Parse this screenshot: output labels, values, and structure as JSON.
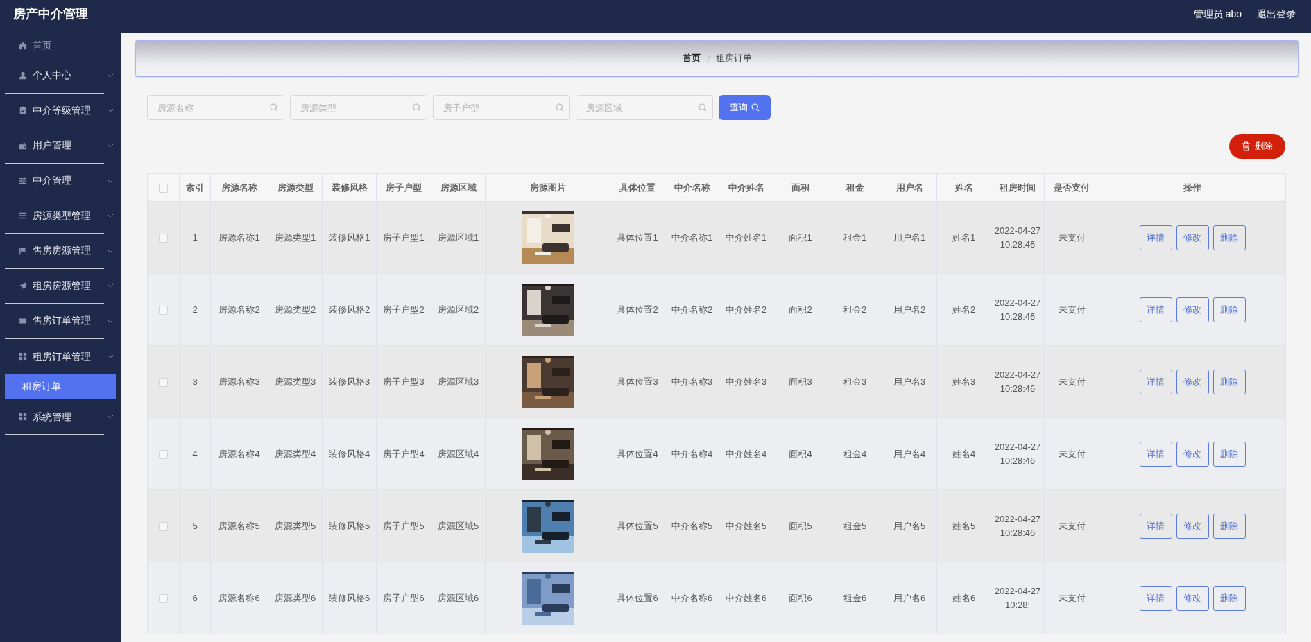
{
  "brand": "房产中介管理",
  "user": {
    "label": "管理员 abo",
    "logout": "退出登录"
  },
  "sidebar": {
    "items": [
      {
        "label": "首页",
        "kind": "link"
      },
      {
        "label": "个人中心",
        "kind": "menu"
      },
      {
        "label": "中介等级管理",
        "kind": "menu"
      },
      {
        "label": "用户管理",
        "kind": "menu"
      },
      {
        "label": "中介管理",
        "kind": "menu"
      },
      {
        "label": "房源类型管理",
        "kind": "menu"
      },
      {
        "label": "售房房源管理",
        "kind": "menu"
      },
      {
        "label": "租房房源管理",
        "kind": "menu"
      },
      {
        "label": "售房订单管理",
        "kind": "menu"
      },
      {
        "label": "租房订单管理",
        "kind": "menu",
        "children": [
          {
            "label": "租房订单",
            "selected": true
          }
        ]
      },
      {
        "label": "系统管理",
        "kind": "menu"
      }
    ]
  },
  "breadcrumb": [
    "首页",
    "租房订单"
  ],
  "search": {
    "fields": [
      {
        "placeholder": "房源名称"
      },
      {
        "placeholder": "房源类型"
      },
      {
        "placeholder": "房子户型"
      },
      {
        "placeholder": "房源区域"
      }
    ],
    "button": "查询"
  },
  "delete_button": "删除",
  "table": {
    "columns": [
      "索引",
      "房源名称",
      "房源类型",
      "装修风格",
      "房子户型",
      "房源区域",
      "房源图片",
      "具体位置",
      "中介名称",
      "中介姓名",
      "面积",
      "租金",
      "用户名",
      "姓名",
      "租房时间",
      "是否支付",
      "操作"
    ],
    "all_checked": false,
    "rows": [
      {
        "checked": false,
        "cells": [
          "1",
          "房源名称1",
          "房源类型1",
          "装修风格1",
          "房子户型1",
          "房源区域1",
          {
            "kind": "picture"
          },
          "具体位置1",
          "中介名称1",
          "中介姓名1",
          "面积1",
          "租金1",
          "用户名1",
          "姓名1",
          "2022-04-27 10:28:46",
          "未支付"
        ],
        "actions": [
          "详情",
          "修改",
          "删除"
        ]
      },
      {
        "checked": false,
        "cells": [
          "2",
          "房源名称2",
          "房源类型2",
          "装修风格2",
          "房子户型2",
          "房源区域2",
          {
            "kind": "picture"
          },
          "具体位置2",
          "中介名称2",
          "中介姓名2",
          "面积2",
          "租金2",
          "用户名2",
          "姓名2",
          "2022-04-27 10:28:46",
          "未支付"
        ],
        "actions": [
          "详情",
          "修改",
          "删除"
        ]
      },
      {
        "checked": false,
        "cells": [
          "3",
          "房源名称3",
          "房源类型3",
          "装修风格3",
          "房子户型3",
          "房源区域3",
          {
            "kind": "picture"
          },
          "具体位置3",
          "中介名称3",
          "中介姓名3",
          "面积3",
          "租金3",
          "用户名3",
          "姓名3",
          "2022-04-27 10:28:46",
          "未支付"
        ],
        "actions": [
          "详情",
          "修改",
          "删除"
        ]
      },
      {
        "checked": false,
        "cells": [
          "4",
          "房源名称4",
          "房源类型4",
          "装修风格4",
          "房子户型4",
          "房源区域4",
          {
            "kind": "picture"
          },
          "具体位置4",
          "中介名称4",
          "中介姓名4",
          "面积4",
          "租金4",
          "用户名4",
          "姓名4",
          "2022-04-27 10:28:46",
          "未支付"
        ],
        "actions": [
          "详情",
          "修改",
          "删除"
        ]
      },
      {
        "checked": false,
        "cells": [
          "5",
          "房源名称5",
          "房源类型5",
          "装修风格5",
          "房子户型5",
          "房源区域5",
          {
            "kind": "picture"
          },
          "具体位置5",
          "中介名称5",
          "中介姓名5",
          "面积5",
          "租金5",
          "用户名5",
          "姓名5",
          "2022-04-27 10:28:46",
          "未支付"
        ],
        "actions": [
          "详情",
          "修改",
          "删除"
        ]
      },
      {
        "checked": false,
        "cells": [
          "6",
          "房源名称6",
          "房源类型6",
          "装修风格6",
          "房子户型6",
          "房源区域6",
          {
            "kind": "picture"
          },
          "具体位置6",
          "中介名称6",
          "中介姓名6",
          "面积6",
          "租金6",
          "用户名6",
          "姓名6",
          "2022-04-27 10:28:",
          "未支付"
        ],
        "actions": [
          "详情",
          "修改",
          "删除"
        ]
      }
    ]
  }
}
